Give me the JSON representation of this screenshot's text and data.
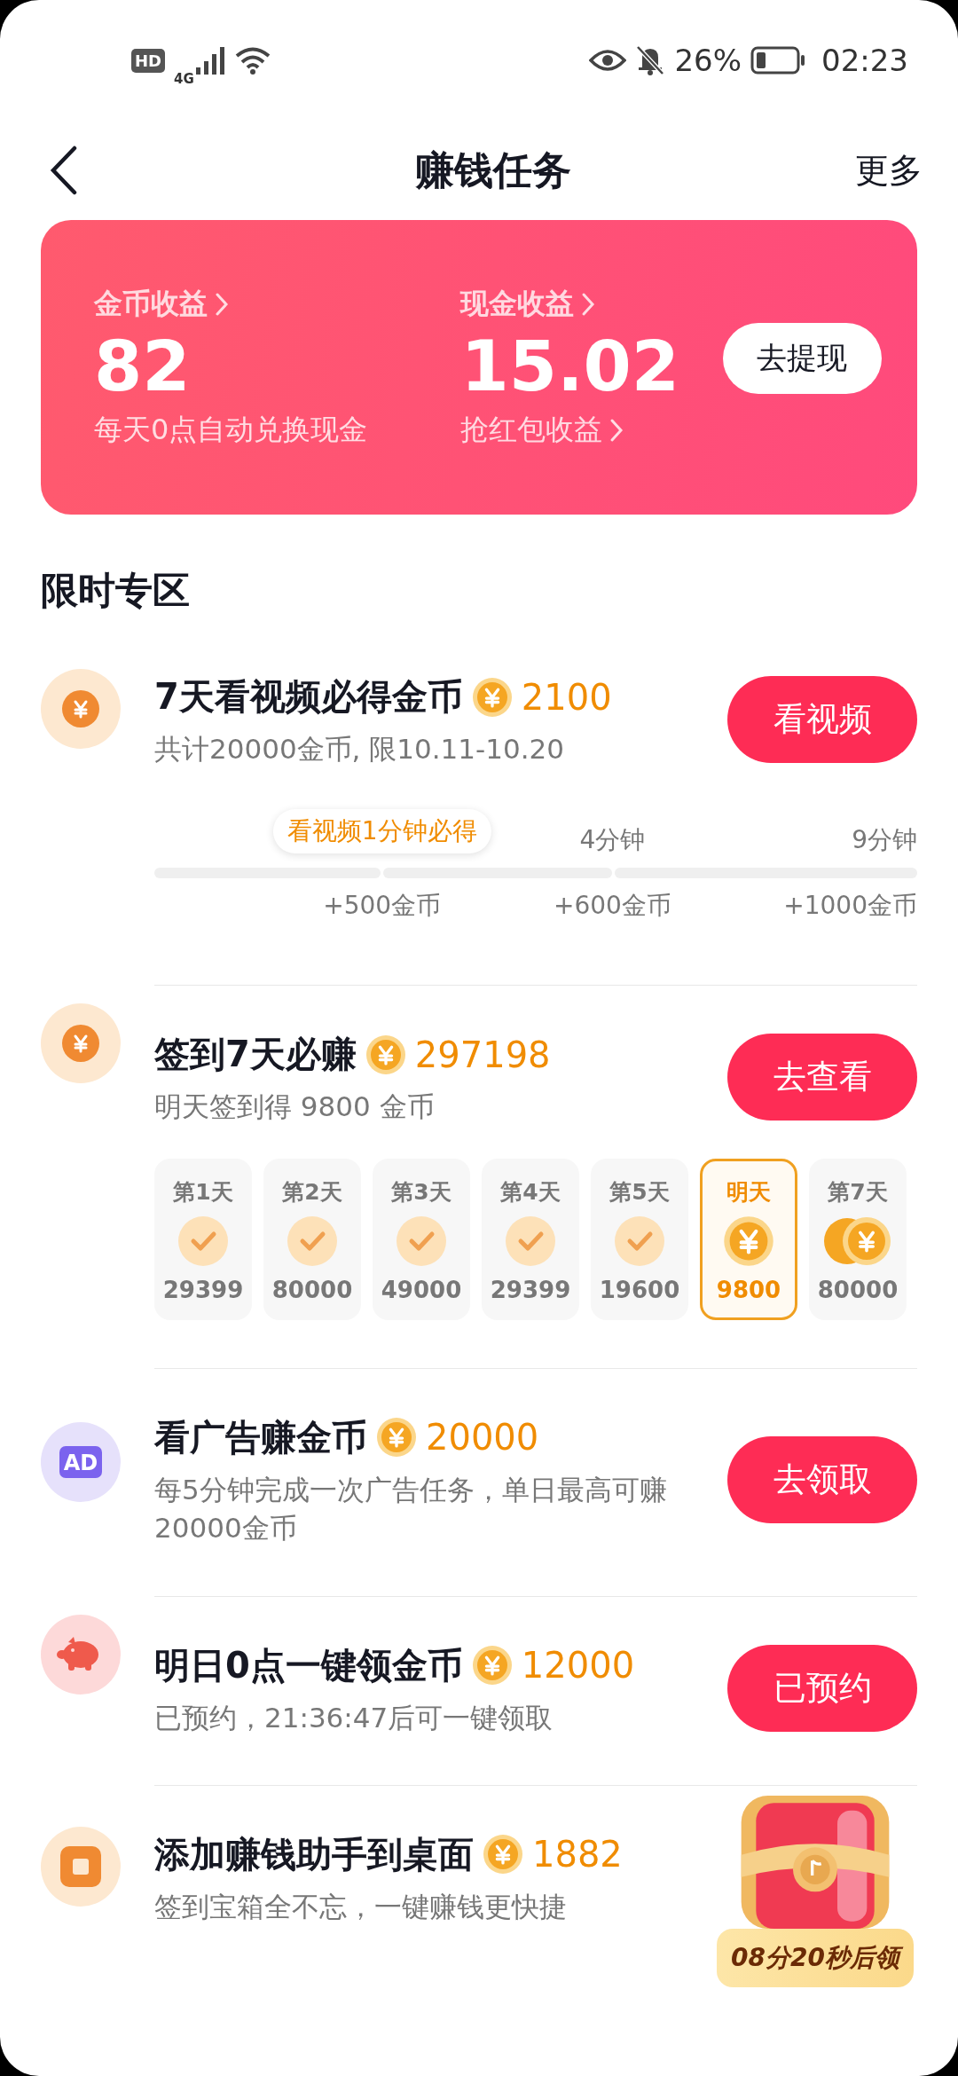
{
  "status_bar": {
    "hd": "HD",
    "network": "4G",
    "battery": "26%",
    "time": "02:23"
  },
  "header": {
    "title": "赚钱任务",
    "more": "更多"
  },
  "earnings": {
    "coin_label": "金币收益",
    "coin_value": "82",
    "coin_note": "每天0点自动兑换现金",
    "cash_label": "现金收益",
    "cash_value": "15.02",
    "cash_link": "抢红包收益",
    "withdraw": "去提现"
  },
  "section_title": "限时专区",
  "tasks": [
    {
      "kind": "coin",
      "title": "7天看视频必得金币",
      "reward": "2100",
      "subtitle": "共计20000金币, 限10.11-10.20",
      "button": "看视频",
      "progress": {
        "level": 0,
        "tip": "看视频1分钟必得",
        "milestones": [
          {
            "bonus": "+500金币"
          },
          {
            "time": "4分钟",
            "bonus": "+600金币"
          },
          {
            "time": "9分钟",
            "bonus": "+1000金币"
          }
        ]
      }
    },
    {
      "kind": "coin",
      "title": "签到7天必赚",
      "reward": "297198",
      "subtitle": "明天签到得 9800 金币",
      "button": "去查看",
      "days": [
        {
          "label": "第1天",
          "amount": "29399",
          "kind": "check",
          "selected": false
        },
        {
          "label": "第2天",
          "amount": "80000",
          "kind": "check",
          "selected": false
        },
        {
          "label": "第3天",
          "amount": "49000",
          "kind": "check",
          "selected": false
        },
        {
          "label": "第4天",
          "amount": "29399",
          "kind": "check",
          "selected": false
        },
        {
          "label": "第5天",
          "amount": "19600",
          "kind": "check",
          "selected": false
        },
        {
          "label": "明天",
          "amount": "9800",
          "kind": "coin",
          "selected": true
        },
        {
          "label": "第7天",
          "amount": "80000",
          "kind": "coins",
          "selected": false
        }
      ]
    },
    {
      "kind": "ad",
      "icon_text": "AD",
      "title": "看广告赚金币",
      "reward": "20000",
      "subtitle": "每5分钟完成一次广告任务，单日最高可赚20000金币",
      "button": "去领取"
    },
    {
      "kind": "piggy",
      "title": "明日0点一键领金币",
      "reward": "12000",
      "subtitle": "已预约，21:36:47后可一键领取",
      "button": "已预约"
    },
    {
      "kind": "square",
      "title": "添加赚钱助手到桌面",
      "reward": "1882",
      "subtitle": "签到宝箱全不忘，一键赚钱更快捷"
    }
  ],
  "chest": {
    "countdown": "08分20秒后领"
  }
}
